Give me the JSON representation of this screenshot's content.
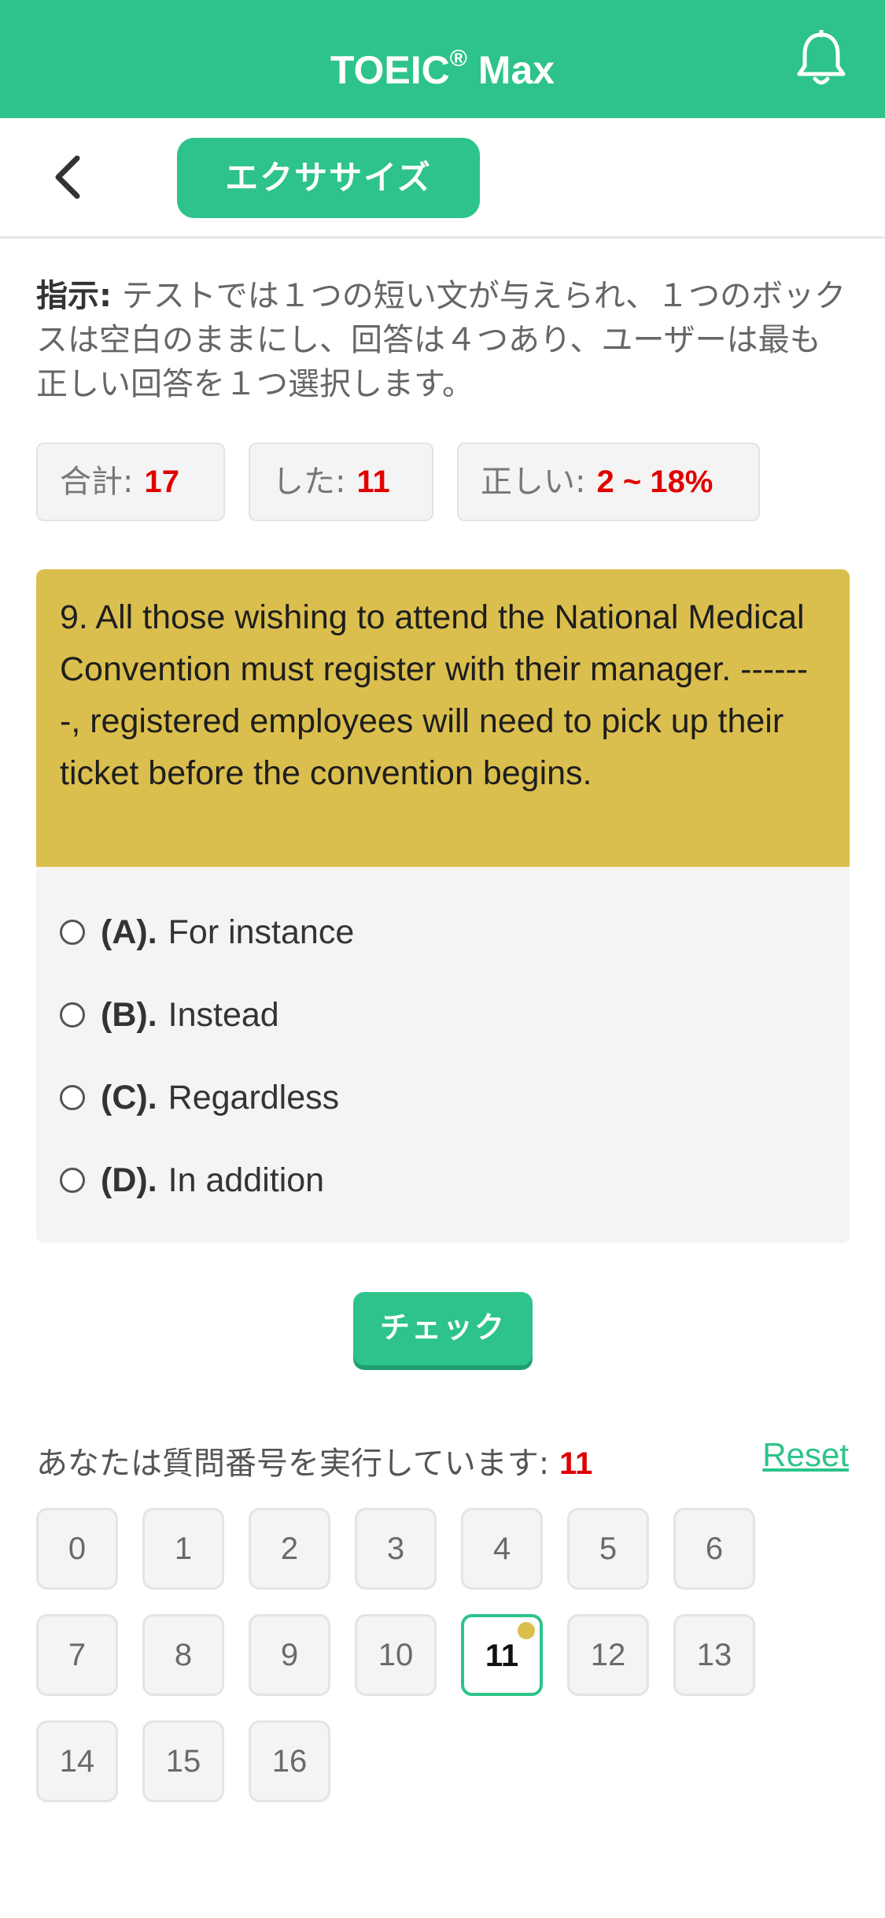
{
  "header": {
    "title": "TOEIC",
    "title_mark": "®",
    "title_suffix": " Max",
    "bell_icon": "bell-icon"
  },
  "nav": {
    "back_icon": "chevron-left-icon",
    "tab_label": "エクササイズ"
  },
  "instructions": {
    "label": "指示:",
    "text": " テストでは１つの短い文が与えられ、１つのボックスは空白のままにし、回答は４つあり、ユーザーは最も正しい回答を１つ選択します。"
  },
  "stats": {
    "total_label": "合計:",
    "total_value": "17",
    "done_label": "した:",
    "done_value": "11",
    "correct_label": "正しい:",
    "correct_value": "2 ~ 18%"
  },
  "question": {
    "text": "9. All those wishing to attend the National Medical Convention must register with their manager. -------, registered employees will need to pick up their ticket before the convention begins.",
    "options": [
      {
        "letter": "(A).",
        "text": "For instance"
      },
      {
        "letter": "(B).",
        "text": "Instead"
      },
      {
        "letter": "(C).",
        "text": "Regardless"
      },
      {
        "letter": "(D).",
        "text": "In addition"
      }
    ]
  },
  "check_label": "チェック",
  "progress": {
    "label": "あなたは質問番号を実行しています:",
    "current": "11",
    "reset_label": "Reset"
  },
  "question_numbers": [
    "0",
    "1",
    "2",
    "3",
    "4",
    "5",
    "6",
    "7",
    "8",
    "9",
    "10",
    "11",
    "12",
    "13",
    "14",
    "15",
    "16"
  ],
  "active_question": "11",
  "colors": {
    "brand": "#2dc38a",
    "question_bg": "#dbbf4e",
    "highlight": "#e00000"
  }
}
